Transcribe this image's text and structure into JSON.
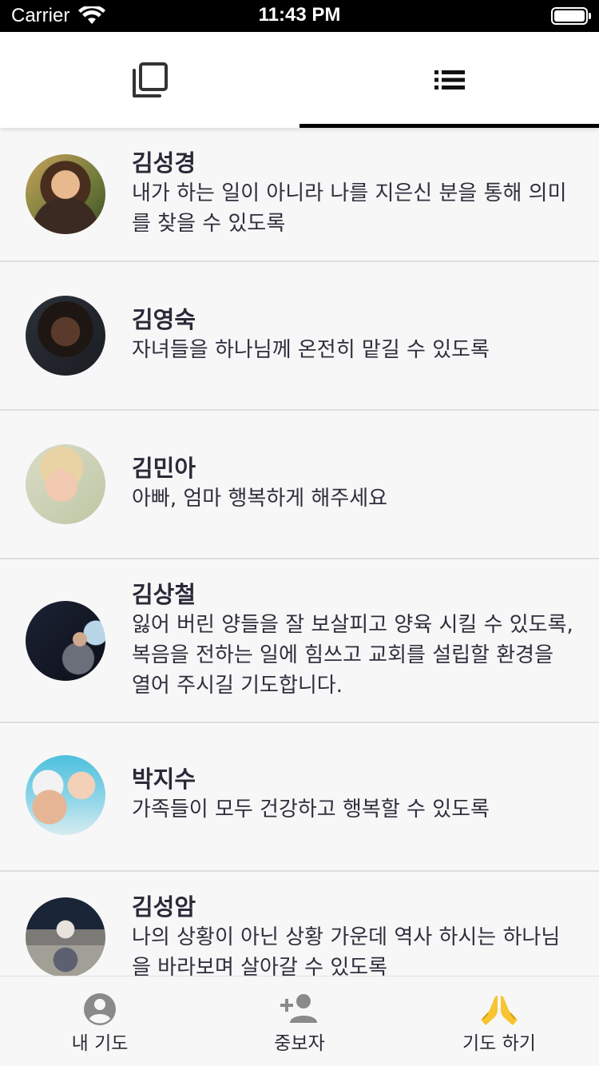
{
  "status_bar": {
    "carrier": "Carrier",
    "time": "11:43 PM"
  },
  "top_tabs": [
    {
      "name": "cards-view",
      "icon": "copy-icon",
      "active": false
    },
    {
      "name": "list-view",
      "icon": "list-icon",
      "active": true
    }
  ],
  "prayers": [
    {
      "name": "김성경",
      "prayer": "내가 하는 일이 아니라 나를 지은신 분을 통해 의미를 찾을 수 있도록"
    },
    {
      "name": "김영숙",
      "prayer": "자녀들을 하나님께 온전히 맡길 수 있도록"
    },
    {
      "name": "김민아",
      "prayer": "아빠, 엄마 행복하게 해주세요"
    },
    {
      "name": "김상철",
      "prayer": "잃어 버린 양들을 잘 보살피고 양육 시킬 수 있도록, 복음을 전하는 일에 힘쓰고 교회를 설립할 환경을 열어 주시길 기도합니다."
    },
    {
      "name": "박지수",
      "prayer": "가족들이 모두 건강하고 행복할 수 있도록"
    },
    {
      "name": "김성암",
      "prayer": "나의 상황이 아닌 상황 가운데 역사 하시는 하나님을 바라보며 살아갈 수 있도록"
    }
  ],
  "bottom_nav": [
    {
      "label": "내 기도",
      "icon": "account-circle-icon"
    },
    {
      "label": "중보자",
      "icon": "person-add-icon"
    },
    {
      "label": "기도 하기",
      "icon": "praying-hands-icon",
      "active": true
    }
  ],
  "colors": {
    "accent": "#f7c531",
    "text": "#2c2c3a",
    "divider": "#dedede",
    "icon_gray": "#8a8a8a"
  }
}
